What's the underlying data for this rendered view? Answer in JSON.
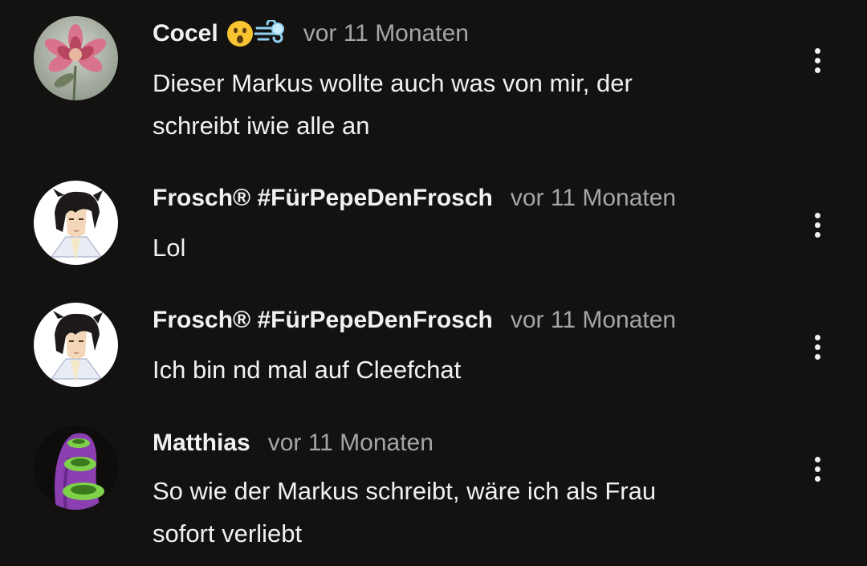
{
  "comments": [
    {
      "author": "Cocel",
      "emojis": [
        "astonished-face-icon",
        "dashing-away-icon"
      ],
      "time": "vor 11 Monaten",
      "text": "Dieser Markus wollte auch was von mir, der\nschreibt iwie alle an",
      "avatar": "pink-flower-avatar"
    },
    {
      "author": "Frosch® #FürPepeDenFrosch",
      "time": "vor 11 Monaten",
      "text": "Lol",
      "avatar": "anime-character-avatar"
    },
    {
      "author": "Frosch® #FürPepeDenFrosch",
      "time": "vor 11 Monaten",
      "text": "Ich bin nd mal auf Cleefchat",
      "avatar": "anime-character-avatar"
    },
    {
      "author": "Matthias",
      "time": "vor 11 Monaten",
      "text": "So wie der Markus schreibt, wäre ich als Frau\nsofort verliebt",
      "avatar": "purple-tentacle-avatar"
    }
  ],
  "colors": {
    "background": "#131210",
    "text": "#f1f1f1",
    "secondary": "#a6a6a6"
  }
}
